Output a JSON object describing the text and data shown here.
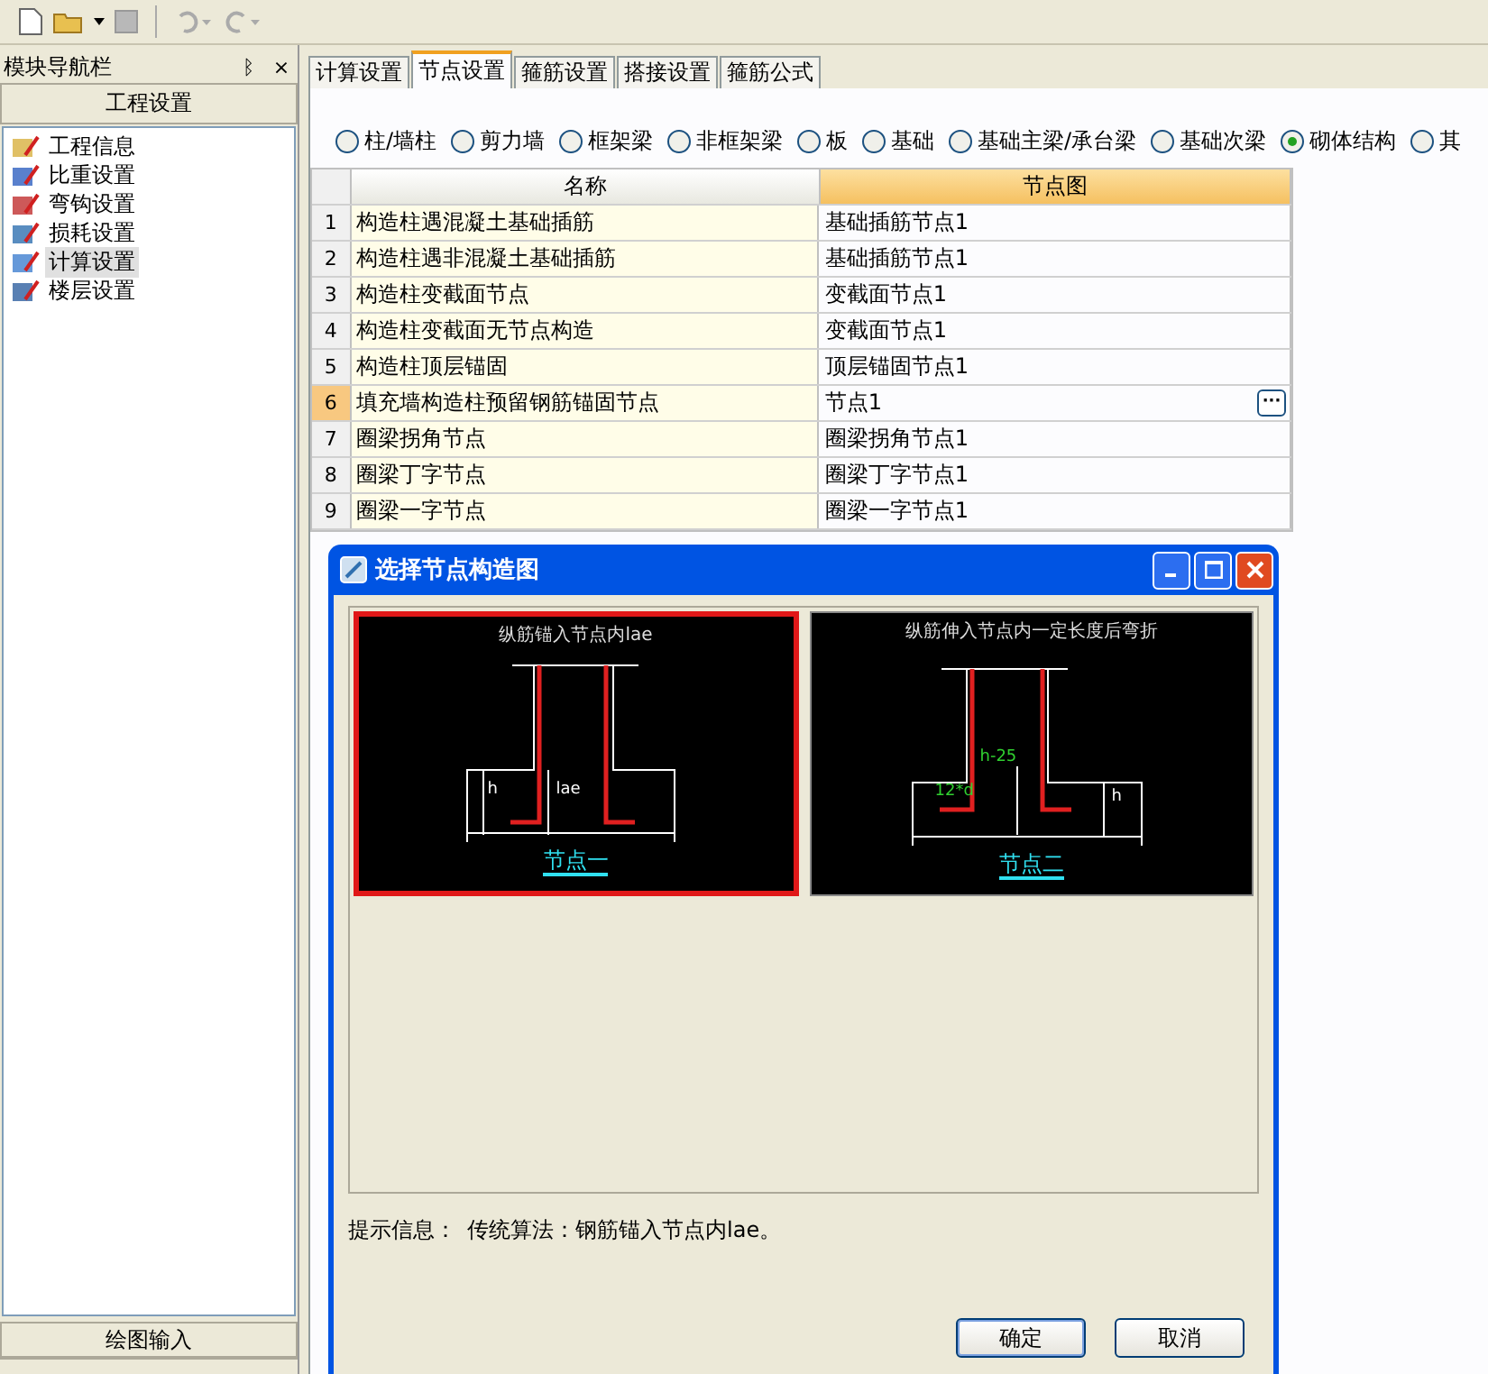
{
  "sidebar": {
    "title": "模块导航栏",
    "pin": "ᛒ",
    "close": "×",
    "section": "工程设置",
    "items": [
      {
        "label": "工程信息",
        "selected": false,
        "kind": "info"
      },
      {
        "label": "比重设置",
        "selected": false,
        "kind": "weight"
      },
      {
        "label": "弯钩设置",
        "selected": false,
        "kind": "hook"
      },
      {
        "label": "损耗设置",
        "selected": false,
        "kind": "loss"
      },
      {
        "label": "计算设置",
        "selected": true,
        "kind": "calc"
      },
      {
        "label": "楼层设置",
        "selected": false,
        "kind": "floor"
      }
    ],
    "bottom_section": "绘图输入"
  },
  "tabs": [
    {
      "label": "计算设置",
      "selected": false
    },
    {
      "label": "节点设置",
      "selected": true
    },
    {
      "label": "箍筋设置",
      "selected": false
    },
    {
      "label": "搭接设置",
      "selected": false
    },
    {
      "label": "箍筋公式",
      "selected": false
    }
  ],
  "radios": [
    {
      "label": "柱/墙柱",
      "selected": false
    },
    {
      "label": "剪力墙",
      "selected": false
    },
    {
      "label": "框架梁",
      "selected": false
    },
    {
      "label": "非框架梁",
      "selected": false
    },
    {
      "label": "板",
      "selected": false
    },
    {
      "label": "基础",
      "selected": false
    },
    {
      "label": "基础主梁/承台梁",
      "selected": false
    },
    {
      "label": "基础次梁",
      "selected": false
    },
    {
      "label": "砌体结构",
      "selected": true
    },
    {
      "label": "其",
      "selected": false
    }
  ],
  "table": {
    "columns": [
      {
        "label": "名称",
        "selected": false
      },
      {
        "label": "节点图",
        "selected": true
      }
    ],
    "rows": [
      {
        "num": "1",
        "name": "构造柱遇混凝土基础插筋",
        "node": "基础插筋节点1",
        "selected": false
      },
      {
        "num": "2",
        "name": "构造柱遇非混凝土基础插筋",
        "node": "基础插筋节点1",
        "selected": false
      },
      {
        "num": "3",
        "name": "构造柱变截面节点",
        "node": "变截面节点1",
        "selected": false
      },
      {
        "num": "4",
        "name": "构造柱变截面无节点构造",
        "node": "变截面节点1",
        "selected": false
      },
      {
        "num": "5",
        "name": "构造柱顶层锚固",
        "node": "顶层锚固节点1",
        "selected": false
      },
      {
        "num": "6",
        "name": "填充墙构造柱预留钢筋锚固节点",
        "node": "节点1",
        "selected": true,
        "button": "···"
      },
      {
        "num": "7",
        "name": "圈梁拐角节点",
        "node": "圈梁拐角节点1",
        "selected": false
      },
      {
        "num": "8",
        "name": "圈梁丁字节点",
        "node": "圈梁丁字节点1",
        "selected": false
      },
      {
        "num": "9",
        "name": "圈梁一字节点",
        "node": "圈梁一字节点1",
        "selected": false
      }
    ]
  },
  "dialog": {
    "title": "选择节点构造图",
    "nodes": [
      {
        "kind": "straight",
        "caption": "纵筋锚入节点内lae",
        "name": "节点一",
        "selected": true,
        "labels": [
          "h",
          "lae"
        ]
      },
      {
        "kind": "bend",
        "caption": "纵筋伸入节点内一定长度后弯折",
        "name": "节点二",
        "selected": false,
        "labels": [
          "12*d",
          "h-25",
          "h"
        ]
      }
    ],
    "hint_label": "提示信息：",
    "hint": "传统算法：钢筋锚入节点内lae。",
    "buttons": [
      "确定",
      "取消"
    ]
  }
}
